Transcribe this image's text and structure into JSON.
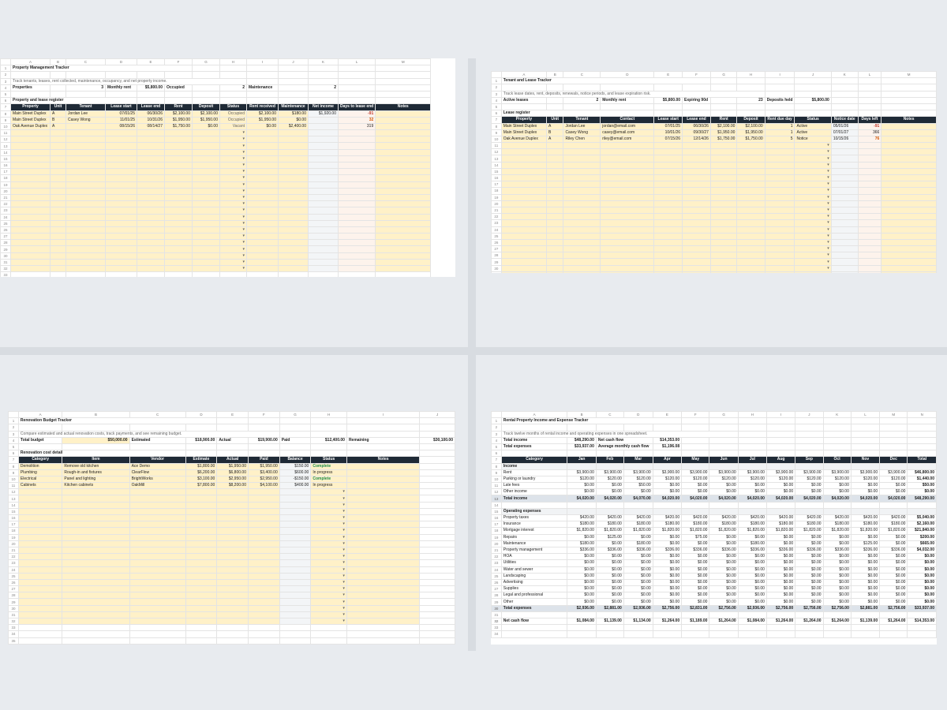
{
  "sheet1": {
    "col_letters": [
      "A",
      "B",
      "C",
      "D",
      "E",
      "F",
      "G",
      "H",
      "I",
      "J",
      "K",
      "L",
      "M"
    ],
    "title": "Property Management Tracker",
    "subtitle": "Track tenants, leases, rent collected, maintenance, occupancy, and net property income.",
    "summary": [
      "Properties",
      "",
      "3",
      "Monthly rent",
      "$5,800.00",
      "Occupied",
      "",
      "2",
      "Maintenance",
      "",
      "2"
    ],
    "section": "Property and lease register",
    "headers": [
      "Property",
      "Unit",
      "Tenant",
      "Lease start",
      "Lease end",
      "Rent",
      "Deposit",
      "Status",
      "Rent received",
      "Maintenance",
      "Net income",
      "Days to lease end",
      "Notes"
    ],
    "rows": [
      [
        "Main Street Duplex",
        "A",
        "Jordan Lee",
        "07/01/25",
        "06/30/26",
        "$2,100.00",
        "$2,100.00",
        "Occupied",
        "$2,100.00",
        "$180.00",
        "$1,920.00",
        "-91",
        ""
      ],
      [
        "Main Street Duplex",
        "B",
        "Casey Wong",
        "11/01/25",
        "10/31/26",
        "$1,950.00",
        "$1,950.00",
        "Occupied",
        "$1,950.00",
        "$0.00",
        "",
        "32",
        ""
      ],
      [
        "Oak Avenue Duplex",
        "A",
        "",
        "08/15/26",
        "08/14/27",
        "$1,750.00",
        "$0.00",
        "Vacant",
        "$0.00",
        "$2,400.00",
        "",
        "319",
        ""
      ]
    ]
  },
  "sheet2": {
    "col_letters": [
      "A",
      "B",
      "C",
      "D",
      "E",
      "F",
      "G",
      "H",
      "I",
      "J",
      "K",
      "L",
      "M"
    ],
    "title": "Tenant and Lease Tracker",
    "subtitle": "Track lease dates, rent, deposits, renewals, notice periods, and lease expiration risk.",
    "summary": [
      "Active leases",
      "",
      "2",
      "Monthly rent",
      "$5,800.00",
      "Expiring 90d",
      "",
      "23",
      "Deposits held",
      "$5,800.00"
    ],
    "section": "Lease register",
    "headers": [
      "Property",
      "Unit",
      "Tenant",
      "Contact",
      "Lease start",
      "Lease end",
      "Rent",
      "Deposit",
      "Rent due day",
      "Status",
      "Notice date",
      "Days left",
      "Notes"
    ],
    "rows": [
      [
        "Main Street Duplex",
        "A",
        "Jordan Lee",
        "jordan@email.com",
        "07/01/25",
        "06/30/26",
        "$2,100.00",
        "$2,100.00",
        "1",
        "Active",
        "05/01/26",
        "-91",
        ""
      ],
      [
        "Main Street Duplex",
        "B",
        "Casey Wong",
        "casey@email.com",
        "10/01/26",
        "09/30/27",
        "$1,950.00",
        "$1,950.00",
        "1",
        "Active",
        "07/01/27",
        "366",
        ""
      ],
      [
        "Oak Avenue Duplex",
        "A",
        "Riley Chen",
        "riley@email.com",
        "07/15/26",
        "12/14/26",
        "$1,750.00",
        "$1,750.00",
        "5",
        "Notice",
        "10/15/26",
        "76",
        ""
      ]
    ]
  },
  "sheet3": {
    "col_letters": [
      "A",
      "B",
      "C",
      "D",
      "E",
      "F",
      "G",
      "H",
      "I",
      "J"
    ],
    "title": "Renovation Budget Tracker",
    "subtitle": "Compare estimated and actual renovation costs, track payments, and see remaining budget.",
    "summary": [
      "Total budget",
      "",
      "$50,000.00",
      "Estimated",
      "$18,900.00",
      "Actual",
      "$19,900.00",
      "Paid",
      "$12,400.00",
      "Remaining",
      "$30,100.00"
    ],
    "section": "Renovation cost detail",
    "headers": [
      "Category",
      "Item",
      "Vendor",
      "Estimate",
      "Actual",
      "Paid",
      "Balance",
      "Status",
      "Notes"
    ],
    "rows": [
      [
        "Demolition",
        "Remove old kitchen",
        "Ace Demo",
        "$1,800.00",
        "$1,950.00",
        "$1,950.00",
        "$150.00",
        "Complete",
        ""
      ],
      [
        "Plumbing",
        "Rough-in and fixtures",
        "ClearFlow",
        "$6,200.00",
        "$6,800.00",
        "$3,400.00",
        "$600.00",
        "In progress",
        ""
      ],
      [
        "Electrical",
        "Panel and lighting",
        "BrightWorks",
        "$3,100.00",
        "$2,950.00",
        "$2,950.00",
        "-$150.00",
        "Complete",
        ""
      ],
      [
        "Cabinets",
        "Kitchen cabinets",
        "OakMill",
        "$7,800.00",
        "$8,200.00",
        "$4,100.00",
        "$400.00",
        "In progress",
        ""
      ]
    ]
  },
  "sheet4": {
    "col_letters": [
      "A",
      "B",
      "C",
      "D",
      "E",
      "F",
      "G",
      "H",
      "I",
      "J",
      "K",
      "L",
      "M",
      "N"
    ],
    "title": "Rental Property Income and Expense Tracker",
    "subtitle": "Track twelve months of rental income and operating expenses in one spreadsheet.",
    "summary1": [
      "Total income",
      "$48,290.00",
      "Net cash flow",
      "$14,353.00"
    ],
    "summary2": [
      "Total expenses",
      "$33,937.00",
      "Average monthly cash flow",
      "$1,196.08"
    ],
    "headers": [
      "Category",
      "Jan",
      "Feb",
      "Mar",
      "Apr",
      "May",
      "Jun",
      "Jul",
      "Aug",
      "Sep",
      "Oct",
      "Nov",
      "Dec",
      "Total"
    ],
    "income_label": "Income",
    "income_rows": [
      [
        "Rent",
        "$3,900.00",
        "$3,900.00",
        "$3,900.00",
        "$3,900.00",
        "$3,900.00",
        "$3,900.00",
        "$3,900.00",
        "$3,900.00",
        "$3,900.00",
        "$3,900.00",
        "$3,900.00",
        "$3,900.00",
        "$46,800.00"
      ],
      [
        "Parking or laundry",
        "$120.00",
        "$120.00",
        "$120.00",
        "$120.00",
        "$120.00",
        "$120.00",
        "$120.00",
        "$120.00",
        "$120.00",
        "$120.00",
        "$120.00",
        "$120.00",
        "$1,440.00"
      ],
      [
        "Late fees",
        "$0.00",
        "$0.00",
        "$50.00",
        "$0.00",
        "$0.00",
        "$0.00",
        "$0.00",
        "$0.00",
        "$0.00",
        "$0.00",
        "$0.00",
        "$0.00",
        "$50.00"
      ],
      [
        "Other income",
        "$0.00",
        "$0.00",
        "$0.00",
        "$0.00",
        "$0.00",
        "$0.00",
        "$0.00",
        "$0.00",
        "$0.00",
        "$0.00",
        "$0.00",
        "$0.00",
        "$0.00"
      ]
    ],
    "total_income": [
      "Total income",
      "$4,020.00",
      "$4,020.00",
      "$4,070.00",
      "$4,020.00",
      "$4,020.00",
      "$4,020.00",
      "$4,020.00",
      "$4,020.00",
      "$4,020.00",
      "$4,020.00",
      "$4,020.00",
      "$4,020.00",
      "$48,290.00"
    ],
    "expense_label": "Operating expenses",
    "expense_rows": [
      [
        "Property taxes",
        "$420.00",
        "$420.00",
        "$420.00",
        "$420.00",
        "$420.00",
        "$420.00",
        "$420.00",
        "$420.00",
        "$420.00",
        "$420.00",
        "$420.00",
        "$420.00",
        "$5,040.00"
      ],
      [
        "Insurance",
        "$180.00",
        "$180.00",
        "$180.00",
        "$180.00",
        "$180.00",
        "$180.00",
        "$180.00",
        "$180.00",
        "$180.00",
        "$180.00",
        "$180.00",
        "$180.00",
        "$2,160.00"
      ],
      [
        "Mortgage interest",
        "$1,820.00",
        "$1,820.00",
        "$1,820.00",
        "$1,820.00",
        "$1,820.00",
        "$1,820.00",
        "$1,820.00",
        "$1,820.00",
        "$1,820.00",
        "$1,820.00",
        "$1,820.00",
        "$1,820.00",
        "$21,840.00"
      ],
      [
        "Repairs",
        "$0.00",
        "$125.00",
        "$0.00",
        "$0.00",
        "$75.00",
        "$0.00",
        "$0.00",
        "$0.00",
        "$0.00",
        "$0.00",
        "$0.00",
        "$0.00",
        "$200.00"
      ],
      [
        "Maintenance",
        "$180.00",
        "$0.00",
        "$180.00",
        "$0.00",
        "$0.00",
        "$0.00",
        "$180.00",
        "$0.00",
        "$0.00",
        "$0.00",
        "$125.00",
        "$0.00",
        "$665.00"
      ],
      [
        "Property management",
        "$336.00",
        "$336.00",
        "$336.00",
        "$336.00",
        "$336.00",
        "$336.00",
        "$336.00",
        "$336.00",
        "$336.00",
        "$336.00",
        "$336.00",
        "$336.00",
        "$4,032.00"
      ],
      [
        "HOA",
        "$0.00",
        "$0.00",
        "$0.00",
        "$0.00",
        "$0.00",
        "$0.00",
        "$0.00",
        "$0.00",
        "$0.00",
        "$0.00",
        "$0.00",
        "$0.00",
        "$0.00"
      ],
      [
        "Utilities",
        "$0.00",
        "$0.00",
        "$0.00",
        "$0.00",
        "$0.00",
        "$0.00",
        "$0.00",
        "$0.00",
        "$0.00",
        "$0.00",
        "$0.00",
        "$0.00",
        "$0.00"
      ],
      [
        "Water and sewer",
        "$0.00",
        "$0.00",
        "$0.00",
        "$0.00",
        "$0.00",
        "$0.00",
        "$0.00",
        "$0.00",
        "$0.00",
        "$0.00",
        "$0.00",
        "$0.00",
        "$0.00"
      ],
      [
        "Landscaping",
        "$0.00",
        "$0.00",
        "$0.00",
        "$0.00",
        "$0.00",
        "$0.00",
        "$0.00",
        "$0.00",
        "$0.00",
        "$0.00",
        "$0.00",
        "$0.00",
        "$0.00"
      ],
      [
        "Advertising",
        "$0.00",
        "$0.00",
        "$0.00",
        "$0.00",
        "$0.00",
        "$0.00",
        "$0.00",
        "$0.00",
        "$0.00",
        "$0.00",
        "$0.00",
        "$0.00",
        "$0.00"
      ],
      [
        "Supplies",
        "$0.00",
        "$0.00",
        "$0.00",
        "$0.00",
        "$0.00",
        "$0.00",
        "$0.00",
        "$0.00",
        "$0.00",
        "$0.00",
        "$0.00",
        "$0.00",
        "$0.00"
      ],
      [
        "Legal and professional",
        "$0.00",
        "$0.00",
        "$0.00",
        "$0.00",
        "$0.00",
        "$0.00",
        "$0.00",
        "$0.00",
        "$0.00",
        "$0.00",
        "$0.00",
        "$0.00",
        "$0.00"
      ],
      [
        "Other",
        "$0.00",
        "$0.00",
        "$0.00",
        "$0.00",
        "$0.00",
        "$0.00",
        "$0.00",
        "$0.00",
        "$0.00",
        "$0.00",
        "$0.00",
        "$0.00",
        "$0.00"
      ]
    ],
    "total_expenses": [
      "Total expenses",
      "$2,936.00",
      "$2,881.00",
      "$2,936.00",
      "$2,756.00",
      "$2,831.00",
      "$2,756.00",
      "$2,936.00",
      "$2,756.00",
      "$2,756.00",
      "$2,756.00",
      "$2,881.00",
      "$2,756.00",
      "$33,937.00"
    ],
    "net_cash_flow": [
      "Net cash flow",
      "$1,084.00",
      "$1,139.00",
      "$1,134.00",
      "$1,264.00",
      "$1,189.00",
      "$1,264.00",
      "$1,084.00",
      "$1,264.00",
      "$1,264.00",
      "$1,264.00",
      "$1,139.00",
      "$1,264.00",
      "$14,353.00"
    ]
  }
}
